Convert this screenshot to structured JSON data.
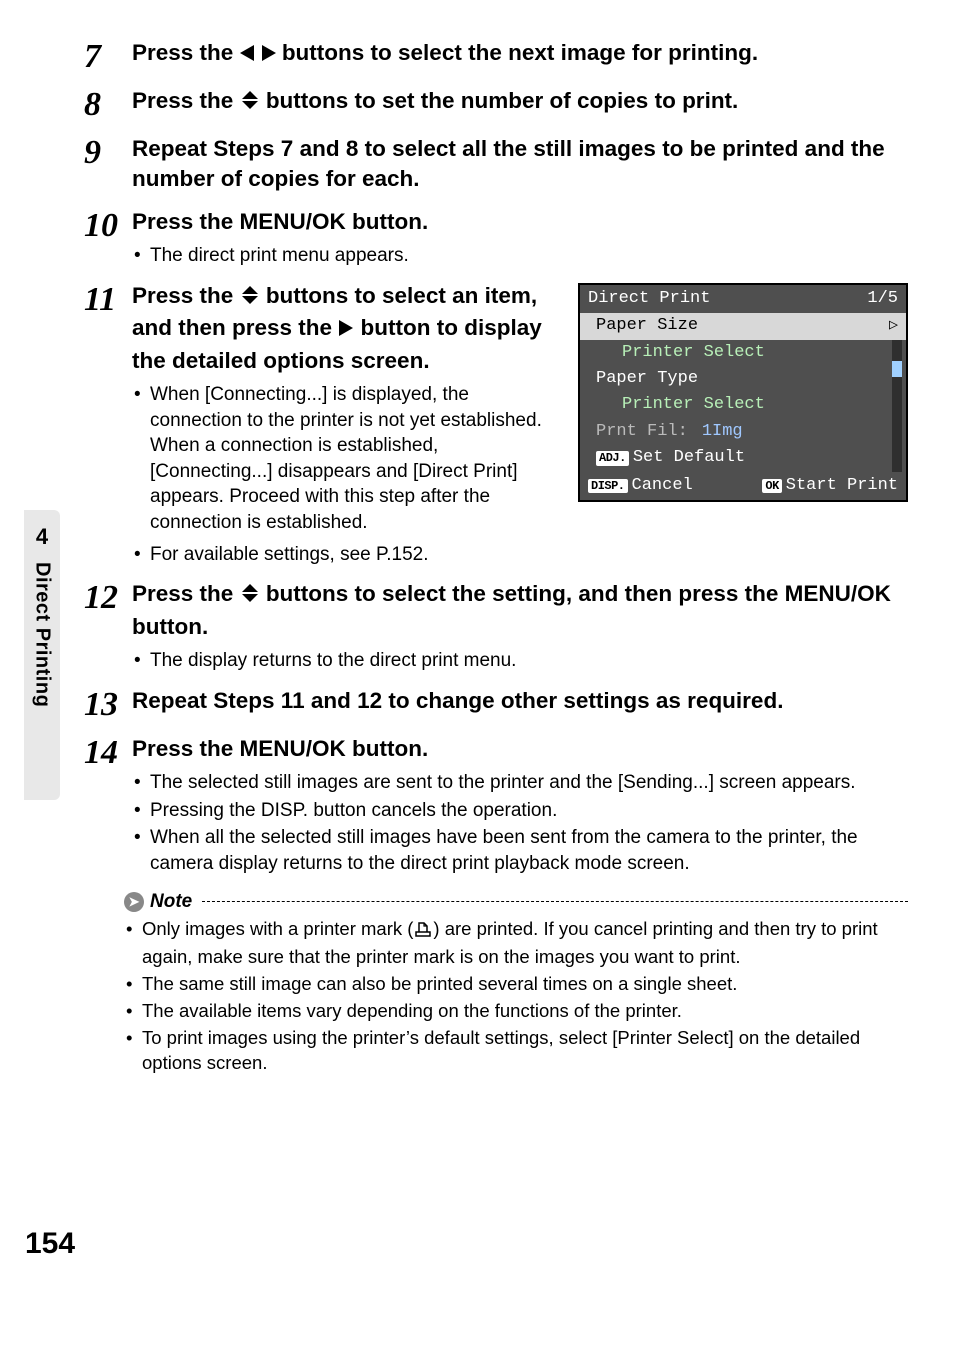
{
  "side_tab": {
    "chapter_number": "4",
    "label": "Direct Printing"
  },
  "page_number": "154",
  "steps": {
    "s7": {
      "num": "7",
      "text_a": "Press the ",
      "text_b": " buttons to select the next image for printing."
    },
    "s8": {
      "num": "8",
      "text_a": "Press the ",
      "text_b": " buttons to set the number of copies to print."
    },
    "s9": {
      "num": "9",
      "text": "Repeat Steps 7 and 8 to select all the still images to be printed and the number of copies for each."
    },
    "s10": {
      "num": "10",
      "text": "Press the MENU/OK button.",
      "sub": [
        "The direct print menu appears."
      ]
    },
    "s11": {
      "num": "11",
      "text_a": "Press the ",
      "text_b": " buttons to select an item, and then press the ",
      "text_c": " button to display the detailed options screen.",
      "sub": [
        "When [Connecting...] is displayed, the connection to the printer is not yet established. When a connection is established, [Connecting...] disappears and [Direct Print] appears. Proceed with this step after the connection is established.",
        "For available settings, see P.152."
      ]
    },
    "s12": {
      "num": "12",
      "text_a": "Press the ",
      "text_b": " buttons to select the setting, and then press the MENU/OK button.",
      "sub": [
        "The display returns to the direct print menu."
      ]
    },
    "s13": {
      "num": "13",
      "text": "Repeat Steps 11 and 12 to change other settings as required."
    },
    "s14": {
      "num": "14",
      "text": "Press the MENU/OK button.",
      "sub": [
        "The selected still images are sent to the printer and the [Sending...] screen appears.",
        "Pressing the DISP. button cancels the operation.",
        "When all the selected still images have been sent from the camera to the printer, the camera display returns to the direct print playback mode screen."
      ]
    }
  },
  "menu": {
    "title": "Direct Print",
    "page": "1/5",
    "item1_label": "Paper Size",
    "item1_value": "Printer Select",
    "item2_label": "Paper Type",
    "item2_value": "Printer Select",
    "row3_label": "Prnt Fil:",
    "row3_value": "1Img",
    "set_default_badge": "ADJ.",
    "set_default": "Set Default",
    "cancel_badge": "DISP.",
    "cancel": "Cancel",
    "start_badge": "OK",
    "start": "Start Print"
  },
  "note": {
    "heading": "Note",
    "items": [
      {
        "a": "Only images with a printer mark (",
        "b": ") are printed. If you cancel printing and then try to print again, make sure that the printer mark is on the images you want to print."
      },
      {
        "text": "The same still image can also be printed several times on a single sheet."
      },
      {
        "text": "The available items vary depending on the functions of the printer."
      },
      {
        "text": "To print images using the printer’s default settings, select [Printer Select] on the detailed options screen."
      }
    ]
  }
}
